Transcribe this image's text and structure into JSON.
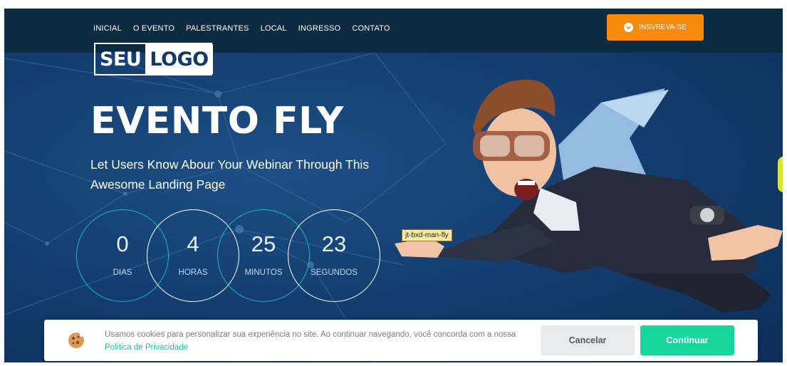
{
  "nav": {
    "items": [
      {
        "label": "INICIAL"
      },
      {
        "label": "O EVENTO"
      },
      {
        "label": "PALESTRANTES"
      },
      {
        "label": "LOCAL"
      },
      {
        "label": "INGRESSO"
      },
      {
        "label": "CONTATO"
      }
    ],
    "cta_label": "INSVREVA-SE"
  },
  "logo": {
    "part1": "SEU",
    "part2": "LOGO"
  },
  "hero": {
    "title": "EVENTO FLY",
    "subtitle": "Let Users Know Abour Your Webinar Through This Awesome Landing Page"
  },
  "countdown": [
    {
      "value": "0",
      "label": "DIAS"
    },
    {
      "value": "4",
      "label": "HORAS"
    },
    {
      "value": "25",
      "label": "MINUTOS"
    },
    {
      "value": "23",
      "label": "SEGUNDOS"
    }
  ],
  "image_tag": "jt-bxd-man-fly",
  "cookie": {
    "text": "Usamos cookies para personalizar sua experiência no site. Ao continuar navegando, você concorda com a nossa ",
    "link": "Política de Privacidade",
    "cancel_label": "Cancelar",
    "continue_label": "Continuar"
  },
  "colors": {
    "topbar": "#0c2a40",
    "hero_bg": "#143f72",
    "cta": "#f7890b",
    "accent_teal": "#18b6c9",
    "continue_button": "#18d49d",
    "cancel_button": "#e9eaec"
  },
  "icons": [
    "chevron-down-icon",
    "cookie-icon"
  ]
}
